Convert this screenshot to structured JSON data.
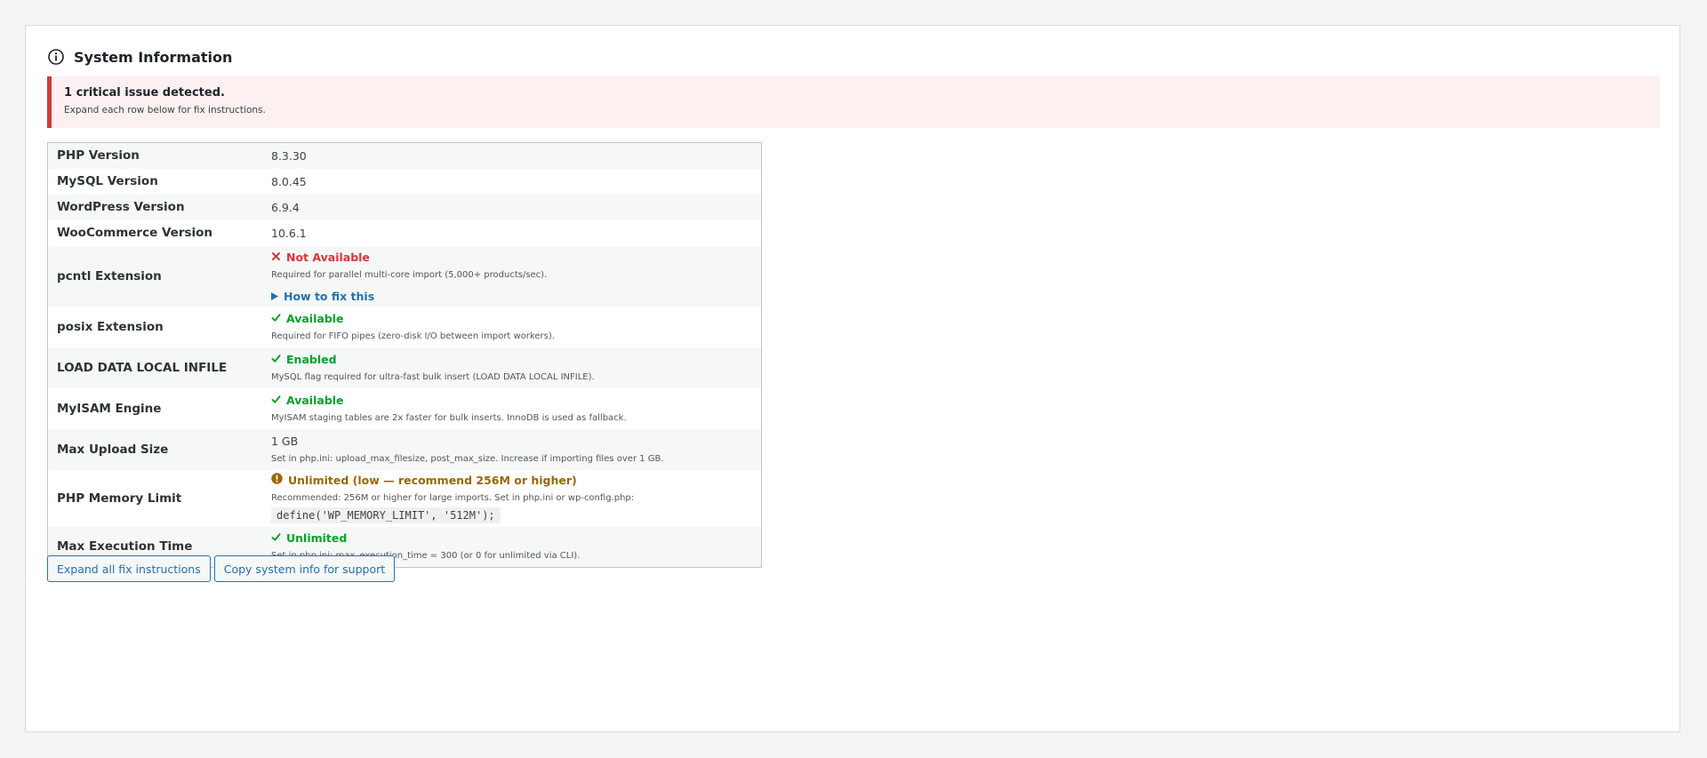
{
  "header": {
    "title": "System Information",
    "icon": "info-circle-icon"
  },
  "notice": {
    "title": "1 critical issue detected.",
    "subtitle": "Expand each row below for fix instructions."
  },
  "rows": {
    "php_version": {
      "label": "PHP Version",
      "value": "8.3.30"
    },
    "mysql_version": {
      "label": "MySQL Version",
      "value": "8.0.45"
    },
    "wordpress_version": {
      "label": "WordPress Version",
      "value": "6.9.4"
    },
    "woocommerce_version": {
      "label": "WooCommerce Version",
      "value": "10.6.1"
    },
    "pcntl": {
      "label": "pcntl Extension",
      "status": "Not Available",
      "status_icon": "cross-icon",
      "description": "Required for parallel multi-core import (5,000+ products/sec).",
      "fix_link": "How to fix this"
    },
    "posix": {
      "label": "posix Extension",
      "status": "Available",
      "status_icon": "check-icon",
      "description": "Required for FIFO pipes (zero-disk I/O between import workers)."
    },
    "load_data": {
      "label": "LOAD DATA LOCAL INFILE",
      "status": "Enabled",
      "status_icon": "check-icon",
      "description": "MySQL flag required for ultra-fast bulk insert (LOAD DATA LOCAL INFILE)."
    },
    "myisam": {
      "label": "MyISAM Engine",
      "status": "Available",
      "status_icon": "check-icon",
      "description": "MyISAM staging tables are 2x faster for bulk inserts. InnoDB is used as fallback."
    },
    "max_upload": {
      "label": "Max Upload Size",
      "value": "1 GB",
      "description": "Set in php.ini: upload_max_filesize, post_max_size. Increase if importing files over 1 GB."
    },
    "memory_limit": {
      "label": "PHP Memory Limit",
      "status": "Unlimited (low — recommend 256M or higher)",
      "status_icon": "warning-icon",
      "description": "Recommended: 256M or higher for large imports. Set in php.ini or wp-config.php:",
      "code": "define('WP_MEMORY_LIMIT', '512M');"
    },
    "max_execution": {
      "label": "Max Execution Time",
      "status": "Unlimited",
      "status_icon": "check-icon",
      "description": "Set in php.ini: max_execution_time = 300 (or 0 for unlimited via CLI)."
    }
  },
  "buttons": {
    "expand_all": "Expand all fix instructions",
    "copy_info": "Copy system info for support"
  },
  "colors": {
    "error": "#d63638",
    "success": "#00a32a",
    "warning": "#996800",
    "link": "#2271b1",
    "notice_bg": "#fcf0f1"
  }
}
